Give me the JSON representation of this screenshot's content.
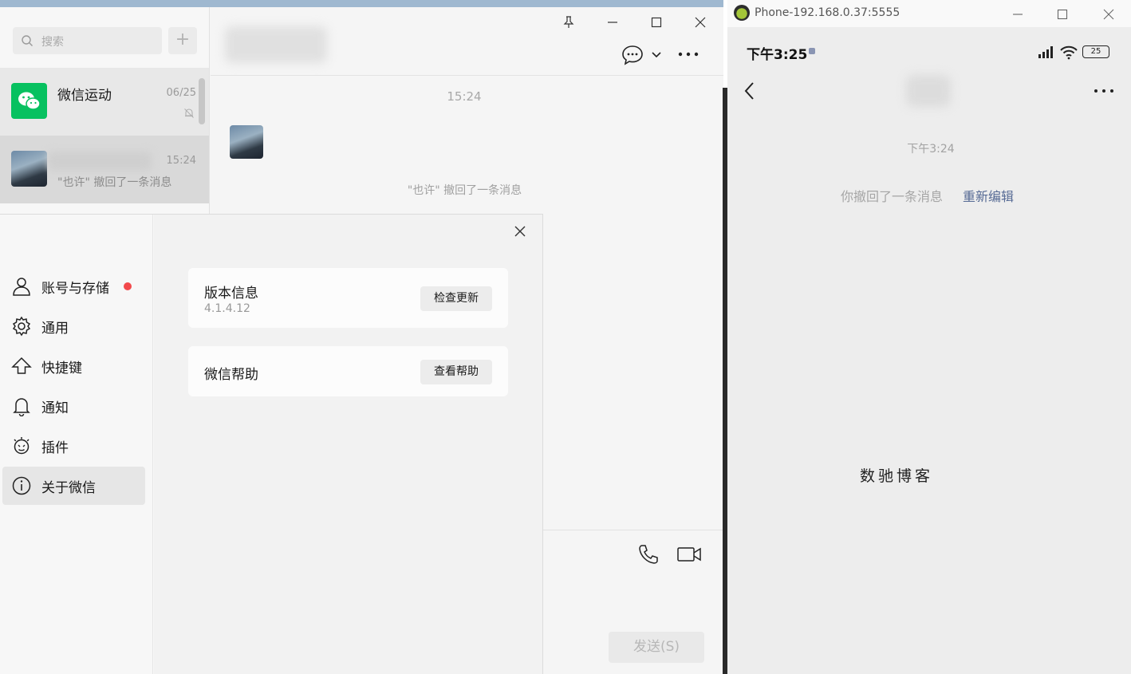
{
  "wechat": {
    "search": {
      "placeholder": "搜索"
    },
    "add_label": "+",
    "chats": [
      {
        "name": "微信运动",
        "time": "06/25",
        "preview": ""
      },
      {
        "name": "",
        "time": "15:24",
        "preview": "\"也许\" 撤回了一条消息"
      }
    ],
    "conversation": {
      "time": "15:24",
      "recall_note": "\"也许\" 撤回了一条消息",
      "send_label": "发送(S)"
    }
  },
  "settings": {
    "nav": [
      {
        "label": "账号与存储",
        "icon": "person-icon",
        "alert": true
      },
      {
        "label": "通用",
        "icon": "gear-icon"
      },
      {
        "label": "快捷键",
        "icon": "arrow-up-icon"
      },
      {
        "label": "通知",
        "icon": "bell-icon"
      },
      {
        "label": "插件",
        "icon": "plugin-icon"
      },
      {
        "label": "关于微信",
        "icon": "info-icon",
        "active": true
      }
    ],
    "version_card": {
      "title": "版本信息",
      "version": "4.1.4.12",
      "button": "检查更新"
    },
    "help_card": {
      "title": "微信帮助",
      "button": "查看帮助"
    }
  },
  "phone": {
    "window_title": "Phone-192.168.0.37:5555",
    "status": {
      "time": "下午3:25",
      "battery": "25"
    },
    "message_time": "下午3:24",
    "recall_text": "你撤回了一条消息",
    "reedit_label": "重新编辑"
  },
  "watermark": "数驰博客",
  "colors": {
    "wechat_green": "#07c160",
    "alert_red": "#f2494b",
    "link_blue": "#576b95"
  }
}
